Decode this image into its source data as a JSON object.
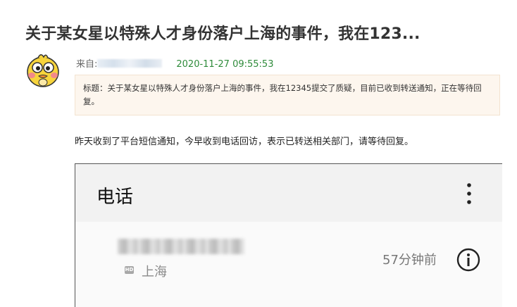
{
  "post": {
    "title": "关于某女星以特殊人才身份落户上海的事件，我在123...",
    "meta_prefix": "来自:",
    "timestamp": "2020-11-27 09:55:53",
    "notice": "标题：关于某女星以特殊人才身份落户上海的事件，我在12345提交了质疑，目前已收到转送通知，正在等待回复。",
    "body": "昨天收到了平台短信通知，今早收到电话回访，表示已转送相关部门，请等待回复。"
  },
  "phone_screen": {
    "title": "电话",
    "hd_label": "HD",
    "location": "上海",
    "call_time": "57分钟前",
    "icons": {
      "menu": "more-vertical-icon",
      "info": "info-icon"
    }
  },
  "colors": {
    "timestamp": "#2e8b3a",
    "notice_bg": "#fdf6ee",
    "phone_header": "#f2f2f2"
  }
}
